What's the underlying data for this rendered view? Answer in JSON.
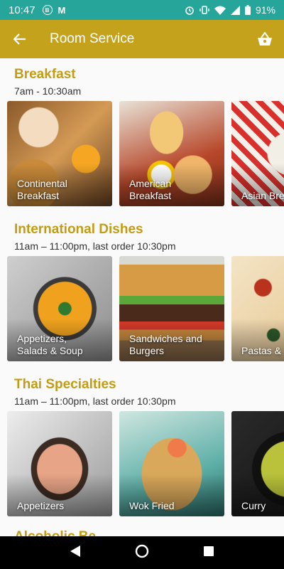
{
  "status_bar": {
    "time": "10:47",
    "battery": "91%",
    "icons": [
      "b-circle-icon",
      "gmail-icon",
      "alarm-icon",
      "vibrate-icon",
      "wifi-icon",
      "signal-icon",
      "battery-icon"
    ]
  },
  "app_bar": {
    "title": "Room Service",
    "background": "#c5a21b"
  },
  "colors": {
    "accent": "#c29c14",
    "status": "#26a69a"
  },
  "sections": [
    {
      "title": "Breakfast",
      "hours": "7am - 10:30am",
      "cards": [
        {
          "label": "Continental\nBreakfast"
        },
        {
          "label": "American\nBreakfast"
        },
        {
          "label": "Asian Bre"
        }
      ]
    },
    {
      "title": "International Dishes",
      "hours": "11am – 11:00pm, last order 10:30pm",
      "cards": [
        {
          "label": "Appetizers,\nSalads & Soup"
        },
        {
          "label": "Sandwiches and\nBurgers"
        },
        {
          "label": "Pastas &"
        }
      ]
    },
    {
      "title": "Thai Specialties",
      "hours": "11am – 11:00pm, last order 10:30pm",
      "cards": [
        {
          "label": "Appetizers"
        },
        {
          "label": "Wok Fried"
        },
        {
          "label": "Curry"
        }
      ]
    }
  ],
  "peek_heading": "Alcoholic Be"
}
